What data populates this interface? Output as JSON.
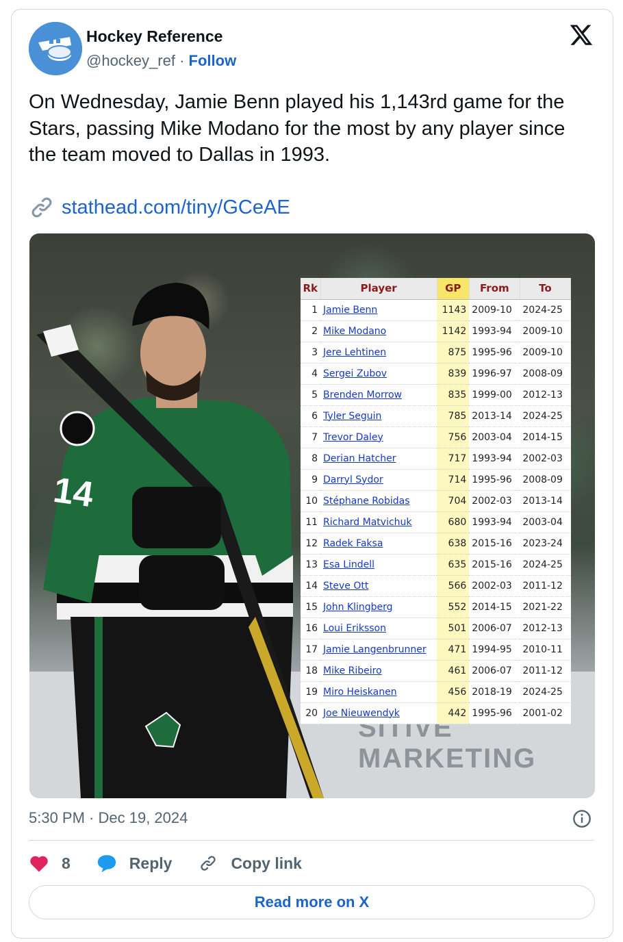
{
  "author": {
    "name": "Hockey Reference",
    "handle": "@hockey_ref",
    "separator": "·",
    "follow_label": "Follow"
  },
  "tweet": {
    "text": "On Wednesday, Jamie Benn played his 1,143rd game for the Stars, passing Mike Modano for the most by any player since the team moved to Dallas in 1993.",
    "link": "stathead.com/tiny/GCeAE"
  },
  "table": {
    "headers": [
      "Rk",
      "Player",
      "GP",
      "From",
      "To"
    ],
    "rows": [
      [
        "1",
        "Jamie Benn",
        "1143",
        "2009-10",
        "2024-25"
      ],
      [
        "2",
        "Mike Modano",
        "1142",
        "1993-94",
        "2009-10"
      ],
      [
        "3",
        "Jere Lehtinen",
        "875",
        "1995-96",
        "2009-10"
      ],
      [
        "4",
        "Sergei Zubov",
        "839",
        "1996-97",
        "2008-09"
      ],
      [
        "5",
        "Brenden Morrow",
        "835",
        "1999-00",
        "2012-13"
      ],
      [
        "6",
        "Tyler Seguin",
        "785",
        "2013-14",
        "2024-25"
      ],
      [
        "7",
        "Trevor Daley",
        "756",
        "2003-04",
        "2014-15"
      ],
      [
        "8",
        "Derian Hatcher",
        "717",
        "1993-94",
        "2002-03"
      ],
      [
        "9",
        "Darryl Sydor",
        "714",
        "1995-96",
        "2008-09"
      ],
      [
        "10",
        "Stéphane Robidas",
        "704",
        "2002-03",
        "2013-14"
      ],
      [
        "11",
        "Richard Matvichuk",
        "680",
        "1993-94",
        "2003-04"
      ],
      [
        "12",
        "Radek Faksa",
        "638",
        "2015-16",
        "2023-24"
      ],
      [
        "13",
        "Esa Lindell",
        "635",
        "2015-16",
        "2024-25"
      ],
      [
        "14",
        "Steve Ott",
        "566",
        "2002-03",
        "2011-12"
      ],
      [
        "15",
        "John Klingberg",
        "552",
        "2014-15",
        "2021-22"
      ],
      [
        "16",
        "Loui Eriksson",
        "501",
        "2006-07",
        "2012-13"
      ],
      [
        "17",
        "Jamie Langenbrunner",
        "471",
        "1994-95",
        "2010-11"
      ],
      [
        "18",
        "Mike Ribeiro",
        "461",
        "2006-07",
        "2011-12"
      ],
      [
        "19",
        "Miro Heiskanen",
        "456",
        "2018-19",
        "2024-25"
      ],
      [
        "20",
        "Joe Nieuwendyk",
        "442",
        "1995-96",
        "2001-02"
      ]
    ]
  },
  "photo": {
    "jersey_number": "14",
    "board_text": "SITIVE MARKETING"
  },
  "meta": {
    "timestamp": "5:30 PM · Dec 19, 2024"
  },
  "actions": {
    "like_count": "8",
    "reply_label": "Reply",
    "copy_label": "Copy link"
  },
  "read_more_label": "Read more on X",
  "icons": [
    "avatar-logo-icon",
    "x-logo-icon",
    "link-icon",
    "info-icon",
    "heart-icon",
    "reply-bubble-icon",
    "copy-link-icon"
  ],
  "colors": {
    "link": "#1d64c9",
    "like": "#e0245e",
    "reply": "#1d9bf0",
    "avatar": "#4a90d6",
    "gp_header": "#f7e66a",
    "gp_cell": "#fdf7c0",
    "header_text": "#8b1a1a"
  }
}
